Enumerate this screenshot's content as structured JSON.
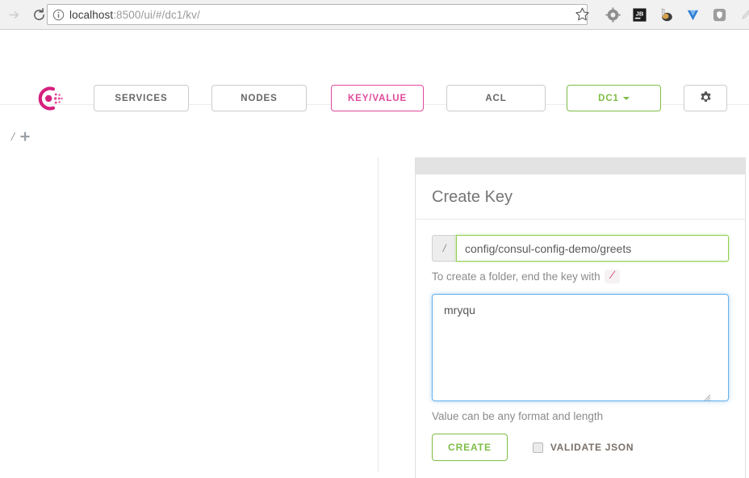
{
  "browser": {
    "forward_icon": "forward-arrow-icon",
    "reload_icon": "reload-icon",
    "security_icon": "info-circle-icon",
    "url_host": "localhost",
    "url_path": ":8500/ui/#/dc1/kv/",
    "bookmark_icon": "star-icon",
    "extensions": [
      {
        "name": "gear-extension-icon",
        "label": ""
      },
      {
        "name": "jetbrains-extension-icon",
        "label": "JB"
      },
      {
        "name": "ink-extension-icon",
        "label": ""
      },
      {
        "name": "yandex-extension-icon",
        "label": ""
      },
      {
        "name": "shield-extension-icon",
        "label": ""
      },
      {
        "name": "eyedropper-extension-icon",
        "label": ""
      }
    ]
  },
  "nav": {
    "logo_name": "consul-logo",
    "items": [
      {
        "label": "SERVICES",
        "state": "default"
      },
      {
        "label": "NODES",
        "state": "default"
      },
      {
        "label": "KEY/VALUE",
        "state": "active"
      },
      {
        "label": "ACL",
        "state": "default"
      },
      {
        "label": "DC1",
        "state": "datacenter"
      }
    ],
    "settings_icon": "gear-icon",
    "colors": {
      "active": "#e0499b",
      "datacenter": "#7fbd46",
      "default_border": "#cccccc",
      "default_text": "#666666"
    }
  },
  "breadcrumb": {
    "root": "/",
    "add_icon": "plus-icon"
  },
  "create_key": {
    "topbar": "",
    "title": "Create Key",
    "key_prefix": "/",
    "key_value": "config/consul-config-demo/greets",
    "key_placeholder": "",
    "key_helper_prefix": "To create a folder, end the key with",
    "key_helper_code": "/",
    "value_text": "mryqu",
    "value_placeholder": "",
    "value_helper": "Value can be any format and length",
    "create_label": "CREATE",
    "validate_label": "VALIDATE JSON",
    "validate_checked": false,
    "colors": {
      "key_focus_border": "#8ed14f",
      "value_focus_border": "#66afe9",
      "create_green": "#7fbd46",
      "code_pink": "#d6457f"
    }
  }
}
